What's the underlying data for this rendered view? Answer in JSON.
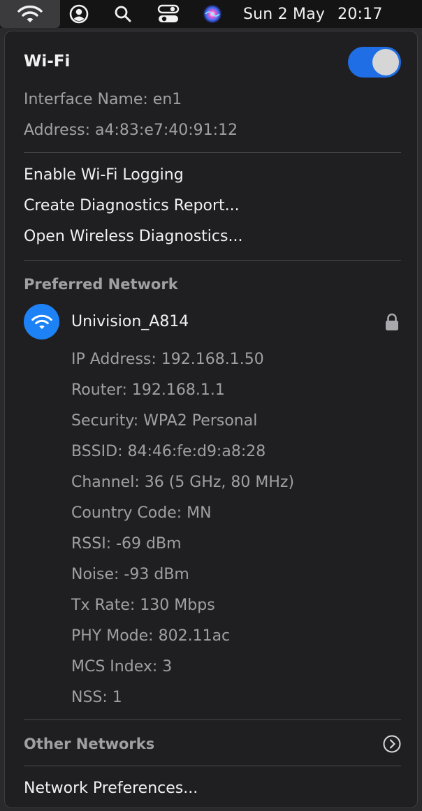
{
  "menubar": {
    "date": "Sun 2 May",
    "time": "20:17",
    "icons": [
      "wifi-icon",
      "user-icon",
      "search-icon",
      "control-center-icon",
      "siri-icon"
    ]
  },
  "panel": {
    "title": "Wi-Fi",
    "toggle_on": true,
    "interface_name": "Interface Name: en1",
    "address": "Address: a4:83:e7:40:91:12",
    "actions": [
      "Enable Wi-Fi Logging",
      "Create Diagnostics Report...",
      "Open Wireless Diagnostics..."
    ],
    "preferred_header": "Preferred Network",
    "network": {
      "name": "Univision_A814",
      "details": [
        "IP Address: 192.168.1.50",
        "Router: 192.168.1.1",
        "Security: WPA2 Personal",
        "BSSID: 84:46:fe:d9:a8:28",
        "Channel: 36 (5 GHz, 80 MHz)",
        "Country Code: MN",
        "RSSI: -69 dBm",
        "Noise: -93 dBm",
        "Tx Rate: 130 Mbps",
        "PHY Mode: 802.11ac",
        "MCS Index: 3",
        "NSS: 1"
      ]
    },
    "other_networks": "Other Networks",
    "network_preferences": "Network Preferences..."
  },
  "colors": {
    "accent": "#1f6ee6",
    "network_badge": "#1e82f7",
    "panel_bg": "#1f1f21",
    "text": "#f1f1f1",
    "dim_text": "#a0a0a4"
  }
}
